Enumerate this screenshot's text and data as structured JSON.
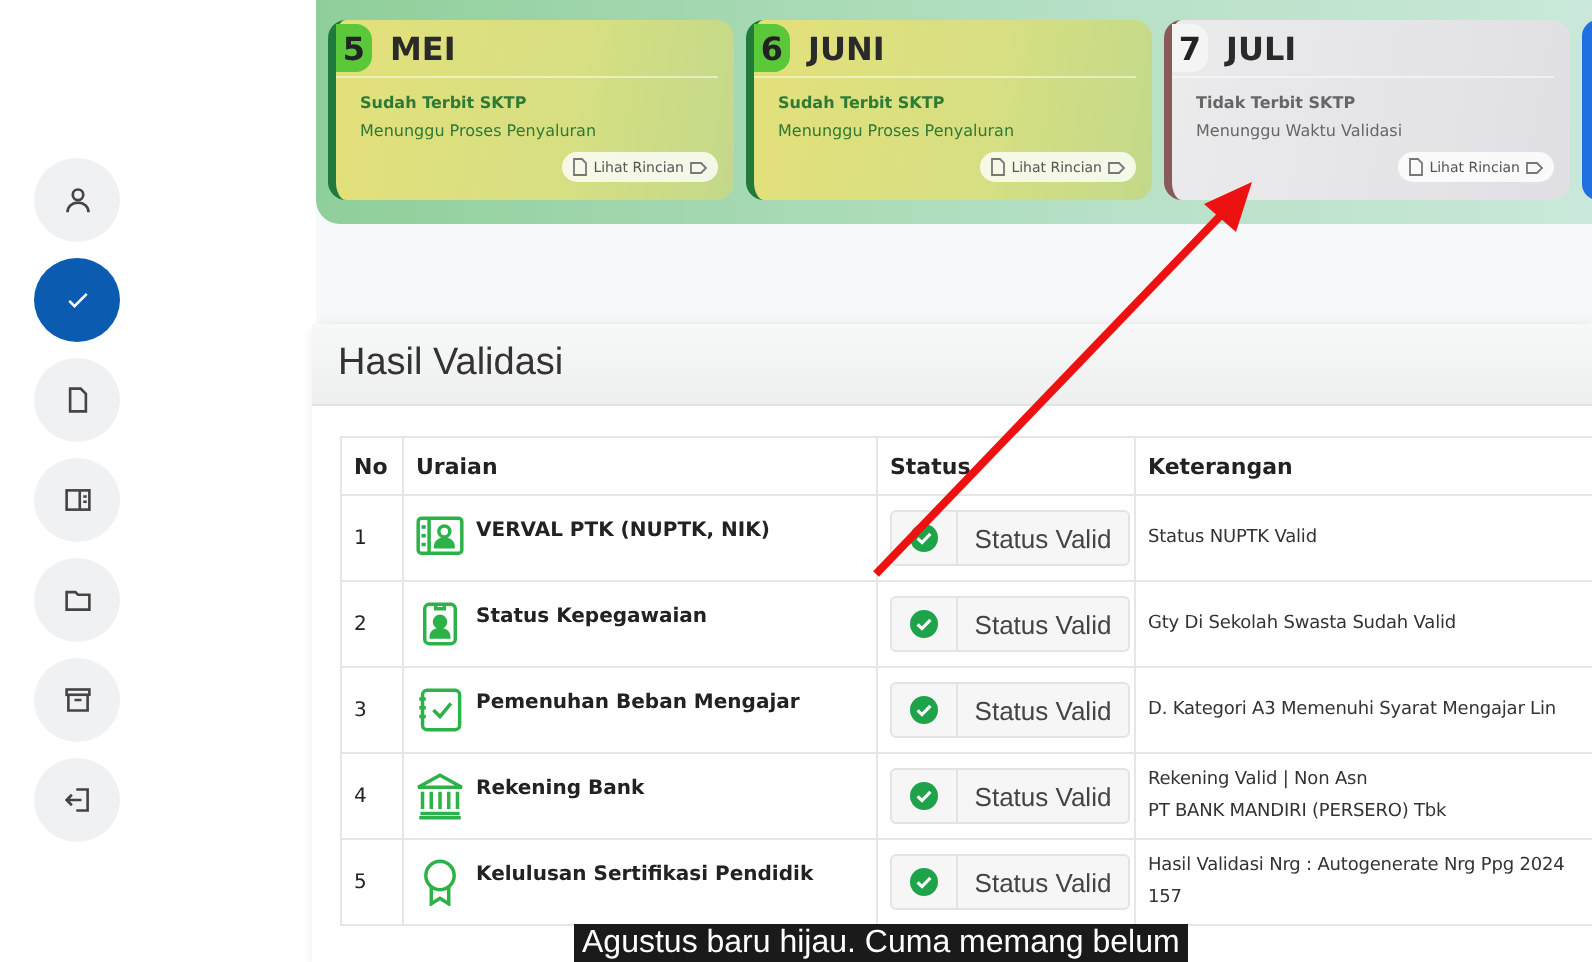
{
  "sidebar": {
    "items": [
      {
        "selected": false
      },
      {
        "selected": true
      },
      {
        "selected": false
      },
      {
        "selected": false
      },
      {
        "selected": false
      },
      {
        "selected": false
      },
      {
        "selected": false
      }
    ]
  },
  "months": [
    {
      "number": "5",
      "name": "MEI",
      "sktp_issued": true,
      "line_1": "Sudah Terbit SKTP",
      "line_2": "Menunggu Proses Penyaluran",
      "button": "Lihat Rincian"
    },
    {
      "number": "6",
      "name": "JUNI",
      "sktp_issued": true,
      "line_1": "Sudah Terbit SKTP",
      "line_2": "Menunggu Proses Penyaluran",
      "button": "Lihat Rincian"
    },
    {
      "number": "7",
      "name": "JULI",
      "sktp_issued": false,
      "line_1": "Tidak Terbit SKTP",
      "line_2": "Menunggu Waktu Validasi",
      "button": "Lihat Rincian"
    }
  ],
  "validation": {
    "title": "Hasil Validasi",
    "columns": [
      "No",
      "Uraian",
      "Status",
      "Keterangan"
    ],
    "rows": [
      {
        "no": "1",
        "uraian": "VERVAL PTK (NUPTK, NIK)",
        "valid": true,
        "status": "Status Valid",
        "keterangan": [
          "Status NUPTK Valid"
        ]
      },
      {
        "no": "2",
        "uraian": "Status Kepegawaian",
        "valid": true,
        "status": "Status Valid",
        "keterangan": [
          "Gty Di Sekolah Swasta Sudah Valid"
        ]
      },
      {
        "no": "3",
        "uraian": "Pemenuhan Beban Mengajar",
        "valid": true,
        "status": "Status Valid",
        "keterangan": [
          "D. Kategori A3 Memenuhi Syarat Mengajar Lin"
        ]
      },
      {
        "no": "4",
        "uraian": "Rekening Bank",
        "valid": true,
        "status": "Status Valid",
        "keterangan": [
          "Rekening Valid | Non Asn",
          "PT BANK MANDIRI (PERSERO) Tbk"
        ]
      },
      {
        "no": "5",
        "uraian": "Kelulusan Sertifikasi Pendidik",
        "valid": true,
        "status": "Status Valid",
        "keterangan": [
          "Hasil Validasi Nrg : Autogenerate Nrg Ppg 2024",
          "157"
        ]
      }
    ]
  },
  "caption": "Agustus baru hijau. Cuma memang belum"
}
